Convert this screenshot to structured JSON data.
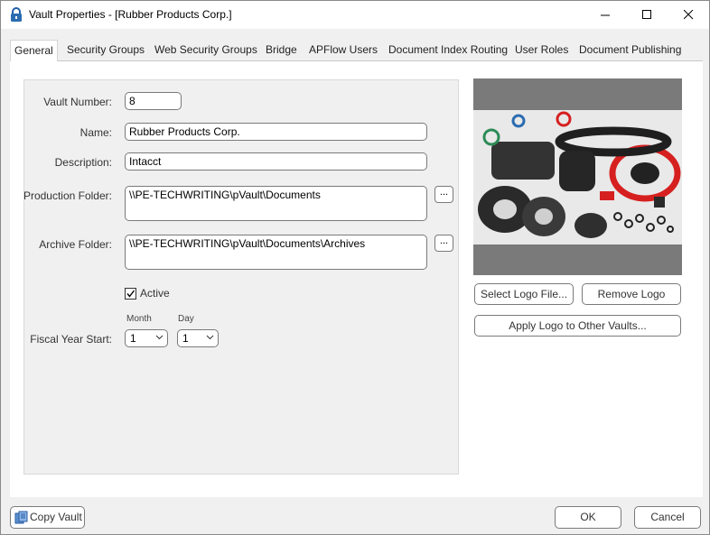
{
  "window": {
    "title": "Vault Properties - [Rubber Products Corp.]"
  },
  "tabs": [
    {
      "label": "General"
    },
    {
      "label": "Security Groups"
    },
    {
      "label": "Web Security Groups"
    },
    {
      "label": "Bridge"
    },
    {
      "label": "APFlow Users"
    },
    {
      "label": "Document Index Routing"
    },
    {
      "label": "User Roles"
    },
    {
      "label": "Document Publishing"
    }
  ],
  "general": {
    "vault_number_label": "Vault Number:",
    "vault_number": "8",
    "name_label": "Name:",
    "name": "Rubber Products Corp.",
    "description_label": "Description:",
    "description": "Intacct",
    "production_folder_label": "Production Folder:",
    "production_folder": "\\\\PE-TECHWRITING\\pVault\\Documents",
    "archive_folder_label": "Archive Folder:",
    "archive_folder": "\\\\PE-TECHWRITING\\pVault\\Documents\\Archives",
    "browse_label": "...",
    "active_label": "Active",
    "active_checked": true,
    "fiscal_year_label": "Fiscal Year Start:",
    "month_label": "Month",
    "month_value": "1",
    "day_label": "Day",
    "day_value": "1"
  },
  "logo": {
    "select_button": "Select Logo File...",
    "remove_button": "Remove Logo",
    "apply_button": "Apply Logo to Other Vaults..."
  },
  "footer": {
    "copy_vault": "Copy Vault",
    "ok": "OK",
    "cancel": "Cancel"
  },
  "colors": {
    "accent_blue": "#2b6cb0",
    "window_bg": "#f0f0f0",
    "logo_frame": "#7a7a7a"
  }
}
